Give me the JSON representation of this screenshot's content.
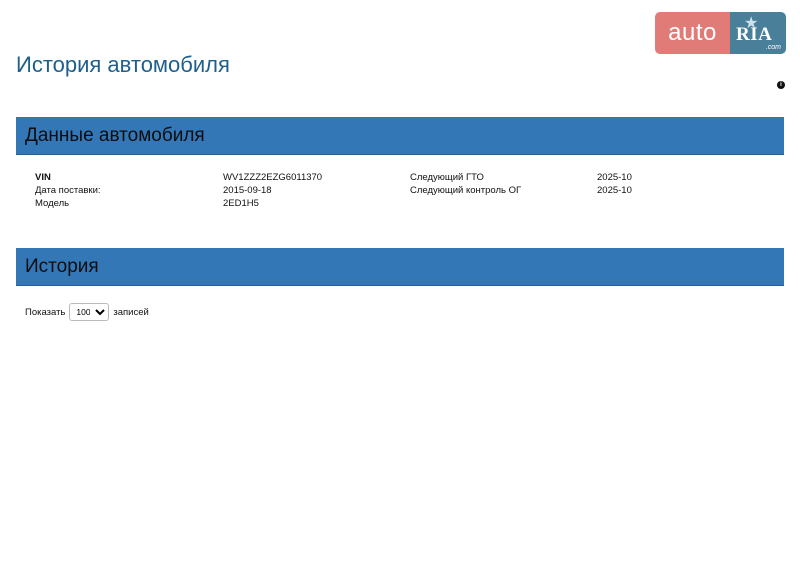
{
  "logo": {
    "auto": "auto",
    "ria": "RIA",
    "com": ".com"
  },
  "page": {
    "title": "История автомобиля"
  },
  "sections": {
    "car_data": {
      "title": "Данные автомобиля"
    },
    "history": {
      "title": "История"
    }
  },
  "vehicle": {
    "rows": [
      {
        "label1": "VIN",
        "value1": "WV1ZZZ2EZG6011370",
        "label2": "Следующий ГТО",
        "value2": "2025-10"
      },
      {
        "label1": "Дата поставки:",
        "value1": "2015-09-18",
        "label2": "Следующий контроль ОГ",
        "value2": "2025-10"
      },
      {
        "label1": "Модель",
        "value1": "2ED1H5",
        "label2": "",
        "value2": ""
      }
    ]
  },
  "entries": {
    "show_label": "Показать",
    "selected": "100",
    "options": [
      "100"
    ],
    "suffix": "записей"
  },
  "colors": {
    "accent_bar": "#3377b7",
    "title": "#1f5f8b",
    "logo_auto": "#e07b77",
    "logo_ria": "#4a7f9a"
  },
  "icons": {
    "info": "info-icon"
  }
}
